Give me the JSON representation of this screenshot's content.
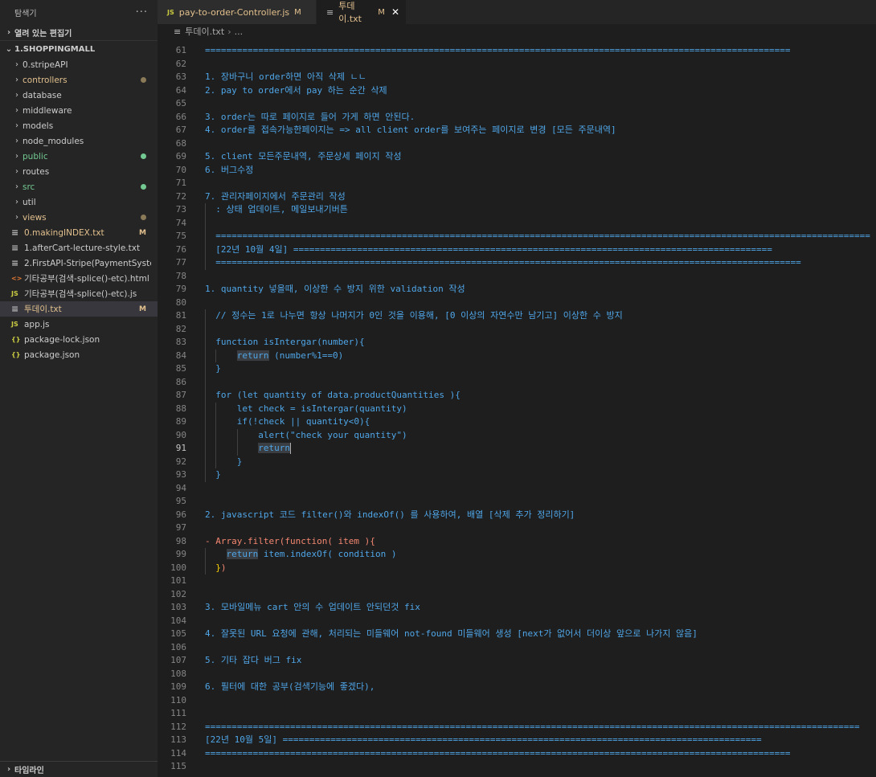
{
  "sidebar": {
    "title": "탐색기",
    "more": "···",
    "open_editors": "열려 있는 편집기",
    "project": "1.SHOPPINGMALL",
    "timeline": "타임라인",
    "tree": [
      {
        "label": "0.stripeAPI",
        "type": "folder"
      },
      {
        "label": "controllers",
        "type": "folder",
        "color": "olive",
        "dot": true
      },
      {
        "label": "database",
        "type": "folder"
      },
      {
        "label": "middleware",
        "type": "folder"
      },
      {
        "label": "models",
        "type": "folder"
      },
      {
        "label": "node_modules",
        "type": "folder"
      },
      {
        "label": "public",
        "type": "folder",
        "color": "green",
        "dot": true
      },
      {
        "label": "routes",
        "type": "folder"
      },
      {
        "label": "src",
        "type": "folder",
        "color": "green",
        "dot": true
      },
      {
        "label": "util",
        "type": "folder"
      },
      {
        "label": "views",
        "type": "folder",
        "color": "olive",
        "dot": true
      },
      {
        "label": "0.makingINDEX.txt",
        "type": "file",
        "icon": "txt",
        "color": "olive",
        "badge": "M"
      },
      {
        "label": "1.afterCart-lecture-style.txt",
        "type": "file",
        "icon": "txt"
      },
      {
        "label": "2.FirstAPI-Stripe(PaymentSyste...",
        "type": "file",
        "icon": "txt"
      },
      {
        "label": "기타공부(검색-splice()-etc).html",
        "type": "file",
        "icon": "html"
      },
      {
        "label": "기타공부(검색-splice()-etc).js",
        "type": "file",
        "icon": "js"
      },
      {
        "label": "투데이.txt",
        "type": "file",
        "icon": "txt",
        "color": "olive",
        "badge": "M",
        "selected": true
      },
      {
        "label": "app.js",
        "type": "file",
        "icon": "js"
      },
      {
        "label": "package-lock.json",
        "type": "file",
        "icon": "json"
      },
      {
        "label": "package.json",
        "type": "file",
        "icon": "json"
      }
    ]
  },
  "tabs": [
    {
      "label": "pay-to-order-Controller.js",
      "icon": "JS",
      "mod": "M",
      "active": false
    },
    {
      "label": "투데이.txt",
      "icon": "txt",
      "mod": "M",
      "active": true,
      "close": "✕"
    }
  ],
  "breadcrumb": {
    "file": "투데이.txt",
    "sep": "›",
    "rest": "..."
  },
  "icons": {
    "js": "JS",
    "txt": "≡",
    "html": "<>",
    "json": "{}",
    "chevron_right": "›",
    "chevron_down": "⌄"
  },
  "lines": [
    {
      "n": "61",
      "t": "=============================================================================================================="
    },
    {
      "n": "62",
      "t": ""
    },
    {
      "n": "63",
      "t": "1. 장바구니 order하면 아직 삭제 ㄴㄴ"
    },
    {
      "n": "64",
      "t": "2. pay to order에서 pay 하는 순간 삭제"
    },
    {
      "n": "65",
      "t": ""
    },
    {
      "n": "66",
      "t": "3. order는 따로 페이지로 들어 가게 하면 안된다."
    },
    {
      "n": "67",
      "t": "4. order를 접속가능한페이지는 => all client order를 보여주는 페이지로 변경 [모든 주문내역]"
    },
    {
      "n": "68",
      "t": ""
    },
    {
      "n": "69",
      "t": "5. client 모든주문내역, 주문상세 페이지 작성"
    },
    {
      "n": "70",
      "t": "6. 버그수정"
    },
    {
      "n": "71",
      "t": ""
    },
    {
      "n": "72",
      "t": "7. 관리자페이지에서 주문관리 작성"
    },
    {
      "n": "73",
      "t": "  : 상태 업데이트, 메일보내기버튼"
    },
    {
      "n": "74",
      "t": ""
    },
    {
      "n": "75",
      "t": "  ==========================================================================================================================="
    },
    {
      "n": "76",
      "t": "  [22년 10월 4일] =========================================================================================="
    },
    {
      "n": "77",
      "t": "  =============================================================================================================="
    },
    {
      "n": "78",
      "t": ""
    },
    {
      "n": "79",
      "t": "1. quantity 넣을때, 이상한 수 방지 위한 validation 작성"
    },
    {
      "n": "80",
      "t": ""
    },
    {
      "n": "81",
      "t": "  // 정수는 1로 나누면 항상 나머지가 0인 것을 이용해, [0 이상의 자연수만 남기고] 이상한 수 방지"
    },
    {
      "n": "82",
      "t": ""
    },
    {
      "n": "83",
      "t": "  function isIntergar(number){"
    },
    {
      "n": "84",
      "t": "      return (number%1==0)"
    },
    {
      "n": "85",
      "t": "  }"
    },
    {
      "n": "86",
      "t": ""
    },
    {
      "n": "87",
      "t": "  for (let quantity of data.productQuantities ){"
    },
    {
      "n": "88",
      "t": "      let check = isIntergar(quantity)"
    },
    {
      "n": "89",
      "t": "      if(!check || quantity<0){"
    },
    {
      "n": "90",
      "t": "          alert(\"check your quantity\")"
    },
    {
      "n": "91",
      "t": "          return"
    },
    {
      "n": "92",
      "t": "      }"
    },
    {
      "n": "93",
      "t": "  }"
    },
    {
      "n": "94",
      "t": ""
    },
    {
      "n": "95",
      "t": ""
    },
    {
      "n": "96",
      "t": "2. javascript 코드 filter()와 indexOf() 를 사용하여, 배열 [삭제 추가 정리하기]"
    },
    {
      "n": "97",
      "t": ""
    },
    {
      "n": "98",
      "t": "- Array.filter(function( item ){"
    },
    {
      "n": "99",
      "t": "    return item.indexOf( condition )"
    },
    {
      "n": "100",
      "t": "  })"
    },
    {
      "n": "101",
      "t": ""
    },
    {
      "n": "102",
      "t": ""
    },
    {
      "n": "103",
      "t": "3. 모바일메뉴 cart 안의 수 업데이트 안되던것 fix"
    },
    {
      "n": "104",
      "t": ""
    },
    {
      "n": "105",
      "t": "4. 잘못된 URL 요청에 관해, 처리되는 미들웨어 not-found 미들웨어 생성 [next가 없어서 더이상 앞으로 나가지 않음]"
    },
    {
      "n": "106",
      "t": ""
    },
    {
      "n": "107",
      "t": "5. 기타 잡다 버그 fix"
    },
    {
      "n": "108",
      "t": ""
    },
    {
      "n": "109",
      "t": "6. 필터에 대한 공부(검색기능에 좋겠다),"
    },
    {
      "n": "110",
      "t": ""
    },
    {
      "n": "111",
      "t": ""
    },
    {
      "n": "112",
      "t": "==========================================================================================================================="
    },
    {
      "n": "113",
      "t": "[22년 10월 5일] =========================================================================================="
    },
    {
      "n": "114",
      "t": "=============================================================================================================="
    },
    {
      "n": "115",
      "t": ""
    }
  ]
}
